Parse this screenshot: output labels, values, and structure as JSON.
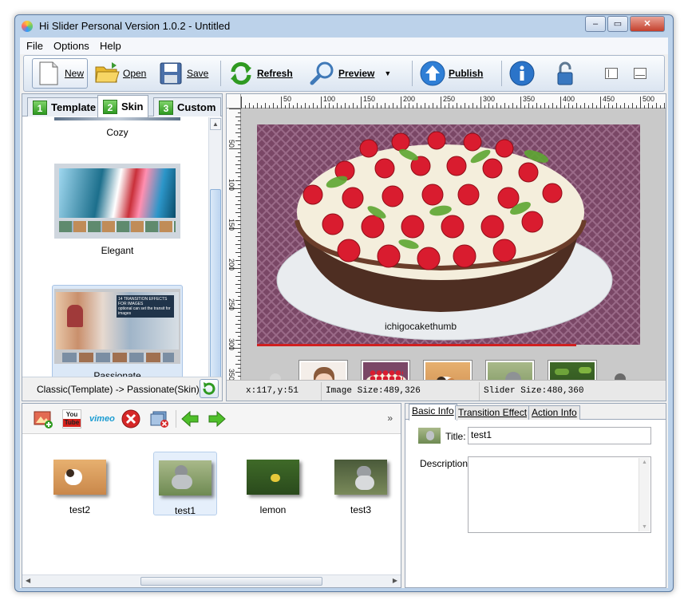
{
  "window": {
    "title": "Hi Slider Personal Version 1.0.2  - Untitled",
    "controls": [
      "–",
      "▭",
      "✕"
    ]
  },
  "menu": [
    "File",
    "Options",
    "Help"
  ],
  "toolbar": {
    "new_label": "New",
    "open_label": "Open",
    "save_label": "Save",
    "refresh_label": "Refresh",
    "preview_label": "Preview",
    "publish_label": "Publish",
    "dropdown_glyph": "▼"
  },
  "left_panel": {
    "tabs": [
      {
        "num": "1",
        "label": "Template"
      },
      {
        "num": "2",
        "label": "Skin"
      },
      {
        "num": "3",
        "label": "Custom"
      }
    ],
    "active_tab": "Skin",
    "skins": [
      {
        "name": "Cozy"
      },
      {
        "name": "Elegant"
      },
      {
        "name": "Passionate",
        "selected": true,
        "banner_text": "14 TRANSITION EFFECTS FOR IMAGES",
        "banner_sub": "optional can set the transit for images"
      }
    ],
    "status_text": "Classic(Template) -> Passionate(Skin)"
  },
  "canvas": {
    "ruler_h_labels": [
      "50",
      "100",
      "150",
      "200",
      "250",
      "300",
      "350",
      "400",
      "450",
      "500"
    ],
    "ruler_v_labels": [
      "50",
      "100",
      "150",
      "200",
      "250",
      "300",
      "350"
    ],
    "slide_caption": "ichigocakethumb",
    "thumbnails": [
      "child",
      "cake",
      "cat-1",
      "cat-2",
      "lemon"
    ],
    "status": {
      "coords": "x:117,y:51",
      "image_size": "Image Size:489,326",
      "slider_size": "Slider Size:480,360"
    }
  },
  "images_panel": {
    "youtube_label": "You Tube",
    "vimeo_label": "vimeo",
    "more_glyph": "»",
    "items": [
      {
        "name": "test2"
      },
      {
        "name": "test1",
        "selected": true
      },
      {
        "name": "lemon"
      },
      {
        "name": "test3"
      }
    ]
  },
  "info_panel": {
    "tabs": [
      "Basic Info",
      "Transition Effect",
      "Action Info"
    ],
    "active_tab": "Basic Info",
    "title_label": "Title:",
    "title_value": "test1",
    "description_label": "Description:",
    "description_value": ""
  },
  "colors": {
    "accent_green": "#2f9a21",
    "progress_red": "#d02020",
    "window_frame": "#bcd2ea"
  }
}
